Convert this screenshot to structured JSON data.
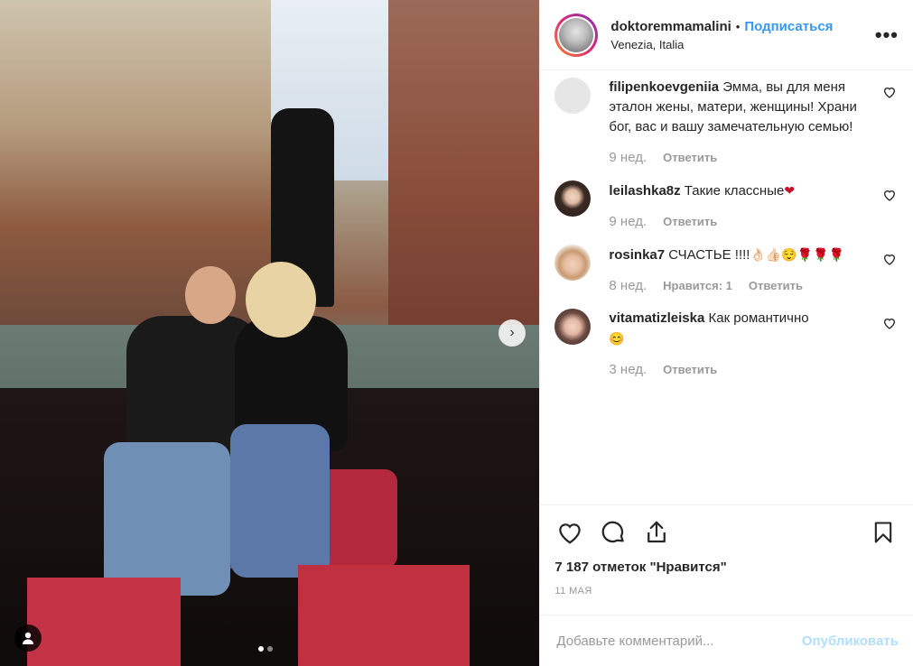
{
  "post": {
    "username": "doktoremmamalini",
    "separator": "•",
    "follow_label": "Подписаться",
    "location": "Venezia, Italia",
    "more_label": "•••"
  },
  "photo": {
    "next_arrow": "›",
    "dots": 2,
    "active_dot": 0
  },
  "comments": [
    {
      "user": "filipenkoevgeniia",
      "text": "Эмма, вы для меня эталон жены, матери, женщины! Храни бог, вас и вашу замечательную семью!",
      "time": "9 нед.",
      "likes": "",
      "reply_label": "Ответить",
      "avatar_color": "#e6e6e6"
    },
    {
      "user": "leilashka8z",
      "text": "Такие классные",
      "emoji": "❤",
      "time": "9 нед.",
      "likes": "",
      "reply_label": "Ответить",
      "avatar_color": "#3a2a24"
    },
    {
      "user": "rosinka7",
      "text": "СЧАСТЬЕ !!!!",
      "emoji": "👌🏻👍🏻😌🌹🌹🌹",
      "time": "8 нед.",
      "likes": "Нравится: 1",
      "reply_label": "Ответить",
      "avatar_color": "#c89a72"
    },
    {
      "user": "vitamatizleiska",
      "text": "Как романтично",
      "emoji": "😊",
      "time": "3 нед.",
      "likes": "",
      "reply_label": "Ответить",
      "avatar_color": "#6a4a40"
    }
  ],
  "actions": {
    "likes_text": "7 187 отметок \"Нравится\"",
    "date": "11 мая"
  },
  "add_comment": {
    "placeholder": "Добавьте комментарий...",
    "post_label": "Опубликовать"
  },
  "colors": {
    "accent": "#3897f0",
    "post_disabled": "#b2dffc",
    "muted": "#999999",
    "text": "#262626"
  }
}
